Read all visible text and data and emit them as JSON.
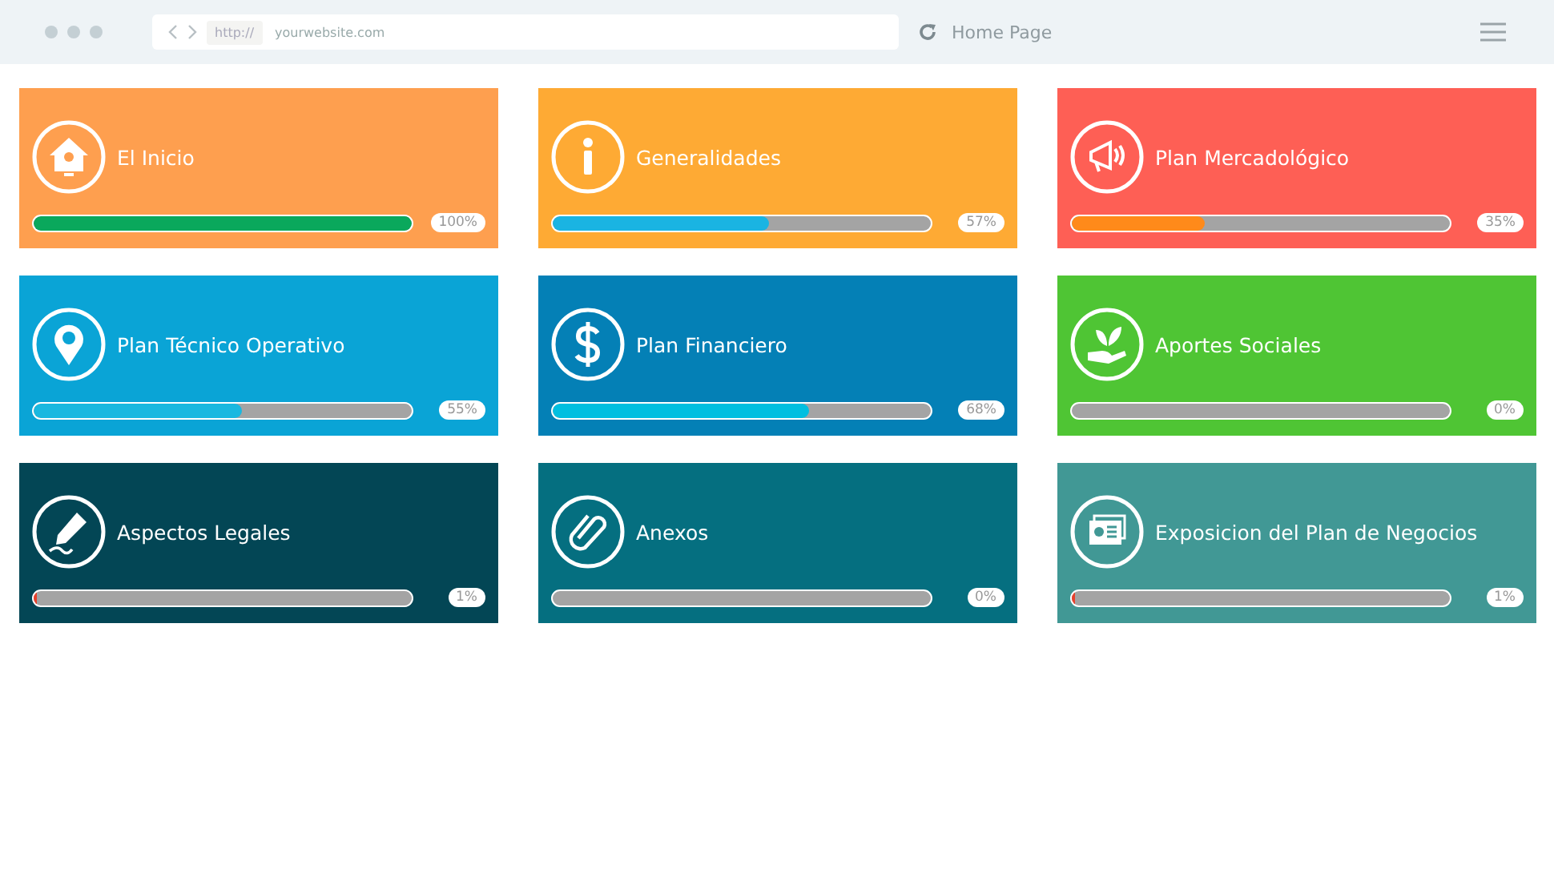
{
  "browser": {
    "protocol": "http://",
    "url": "yourwebsite.com",
    "page_title": "Home Page"
  },
  "cards": [
    {
      "title": "El Inicio",
      "kind": "house",
      "color": "#fe9f4f",
      "bar": {
        "color": "#0aa85c",
        "level": 1.0
      },
      "reading": "100%"
    },
    {
      "title": "Generalidades",
      "kind": "info",
      "color": "#feaa34",
      "bar": {
        "color": "#1ab4e2",
        "level": 0.57
      },
      "reading": "57%"
    },
    {
      "title": "Plan Mercadológico",
      "kind": "megaphone",
      "color": "#fe5f55",
      "bar": {
        "color": "#ff8a1a",
        "level": 0.35
      },
      "reading": "35%"
    },
    {
      "title": "Plan Técnico Operativo",
      "kind": "pin",
      "color": "#0aa4d6",
      "bar": {
        "color": "#19b8e0",
        "level": 0.55
      },
      "reading": "55%"
    },
    {
      "title": "Plan Financiero",
      "kind": "dollar",
      "color": "#0480b6",
      "bar": {
        "color": "#00bfe0",
        "level": 0.68
      },
      "reading": "68%"
    },
    {
      "title": "Aportes Sociales",
      "kind": "plant",
      "color": "#4fc534",
      "reading": "0%"
    },
    {
      "title": "Aspectos Legales",
      "kind": "pen",
      "color": "#034655",
      "bar": {
        "color": "#e8412c",
        "level": 0.01
      },
      "reading": "1%"
    },
    {
      "title": "Anexos",
      "kind": "clip",
      "color": "#056f80",
      "reading": "0%"
    },
    {
      "title": "Exposicion del Plan de Negocios",
      "kind": "slides",
      "color": "#419895",
      "bar": {
        "color": "#e8412c",
        "level": 0.01
      },
      "reading": "1%"
    }
  ]
}
